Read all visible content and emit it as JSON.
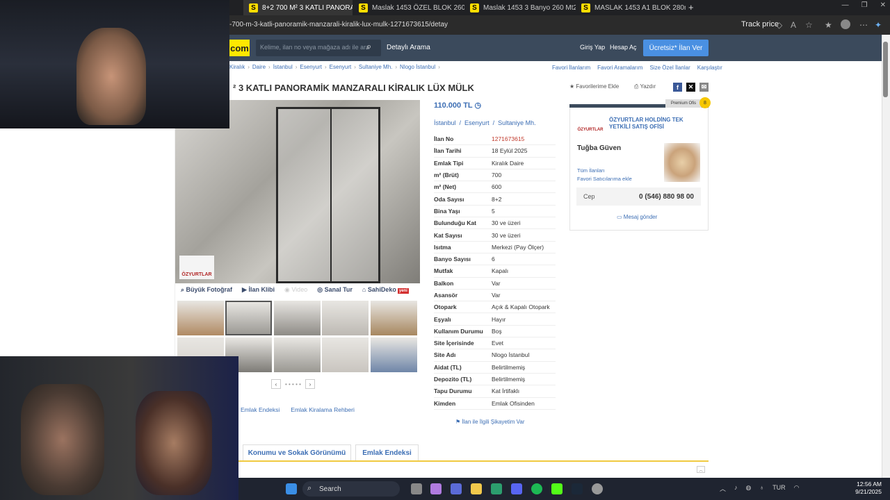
{
  "browser": {
    "tabs": [
      {
        "label": "8+2 700 M² 3 KATLI PANORAMİ"
      },
      {
        "label": "Maslak 1453 ÖZEL BLOK 260 M²"
      },
      {
        "label": "Maslak 1453 3 Banyo 260 Mt2 Be"
      },
      {
        "label": "MASLAK 1453 A1 BLOK 280m2 Ef"
      }
    ],
    "url": "-700-m-3-katli-panoramik-manzarali-kiralik-lux-mulk-1271673615/detay",
    "track_price": "Track price",
    "new_tab": "+"
  },
  "header": {
    "logo": "com",
    "search_placeholder": "Kelime, ilan no veya mağaza adı ile ara",
    "detail_search": "Detaylı Arama",
    "login": "Giriş Yap",
    "signup": "Hesap Aç",
    "post_ad": "Ücretsiz* İlan Ver"
  },
  "breadcrumb": [
    "Kiralık",
    "Daire",
    "İstanbul",
    "Esenyurt",
    "Esenyurt",
    "Sultaniye Mh.",
    "Nlogo İstanbul"
  ],
  "top_links": [
    "Favori İlanlarım",
    "Favori Aramalarım",
    "Size Özel İlanlar",
    "Karşılaştır"
  ],
  "listing": {
    "title": "² 3 KATLI PANORAMİK MANZARALI KİRALIK LÜX MÜLK",
    "add_favorite": "Favorilerime Ekle",
    "print": "Yazdır",
    "price": "110.000 TL",
    "location": [
      "İstanbul",
      "/",
      "Esenyurt",
      "/",
      "Sultaniye Mh."
    ],
    "details": [
      {
        "k": "İlan No",
        "v": "1271673615"
      },
      {
        "k": "İlan Tarihi",
        "v": "18 Eylül 2025"
      },
      {
        "k": "Emlak Tipi",
        "v": "Kiralık Daire"
      },
      {
        "k": "m² (Brüt)",
        "v": "700"
      },
      {
        "k": "m² (Net)",
        "v": "600"
      },
      {
        "k": "Oda Sayısı",
        "v": "8+2"
      },
      {
        "k": "Bina Yaşı",
        "v": "5"
      },
      {
        "k": "Bulunduğu Kat",
        "v": "30 ve üzeri"
      },
      {
        "k": "Kat Sayısı",
        "v": "30 ve üzeri"
      },
      {
        "k": "Isıtma",
        "v": "Merkezi (Pay Ölçer)"
      },
      {
        "k": "Banyo Sayısı",
        "v": "6"
      },
      {
        "k": "Mutfak",
        "v": "Kapalı"
      },
      {
        "k": "Balkon",
        "v": "Var"
      },
      {
        "k": "Asansör",
        "v": "Var"
      },
      {
        "k": "Otopark",
        "v": "Açık & Kapalı Otopark"
      },
      {
        "k": "Eşyalı",
        "v": "Hayır"
      },
      {
        "k": "Kullanım Durumu",
        "v": "Boş"
      },
      {
        "k": "Site İçerisinde",
        "v": "Evet"
      },
      {
        "k": "Site Adı",
        "v": "Nlogo İstanbul"
      },
      {
        "k": "Aidat (TL)",
        "v": "Belirtilmemiş"
      },
      {
        "k": "Depozito (TL)",
        "v": "Belirtilmemiş"
      },
      {
        "k": "Tapu Durumu",
        "v": "Kat İrtifaklı"
      },
      {
        "k": "Kimden",
        "v": "Emlak Ofisinden"
      }
    ],
    "complaint": "İlan ile İlgili Şikayetim Var"
  },
  "photo": {
    "watermark": "ÖZYURTLAR",
    "tools": [
      "Büyük Fotoğraf",
      "İlan Klibi",
      "Video",
      "Sanal Tur",
      "SahiDeko"
    ],
    "new_badge": "yeni",
    "thumbnail_colors": [
      "#b08a63",
      "#9c9a95",
      "#8e8b86",
      "#bdb9b3",
      "#a7875f",
      "#d4d0ca",
      "#7d7b76",
      "#9a9892",
      "#c9c5bf",
      "#6f86a8"
    ],
    "pager_prev": "‹",
    "pager_next": "›",
    "pager_dots": "• • • • •"
  },
  "seller": {
    "badge": "Premium Ofis",
    "medal": "8",
    "logo": "ÖZYURTLAR",
    "office_name": "ÖZYURTLAR HOLDİNG TEK YETKİLİ SATIŞ OFİSİ",
    "agent": "Tuğba Güven",
    "all_ads": "Tüm İlanları",
    "add_fav_seller": "Favori Satıcılarıma ekle",
    "phone_label": "Cep",
    "phone": "0 (546) 880 98 00",
    "message": "Mesaj gönder"
  },
  "bottom": {
    "links": [
      "Emlak Endeksi",
      "Emlak Kiralama Rehberi"
    ],
    "tabs": [
      "Konumu ve Sokak Görünümü",
      "Emlak Endeksi"
    ]
  },
  "taskbar": {
    "search": "Search",
    "lang": "TUR",
    "time": "12:56 AM",
    "date": "9/21/2025"
  }
}
